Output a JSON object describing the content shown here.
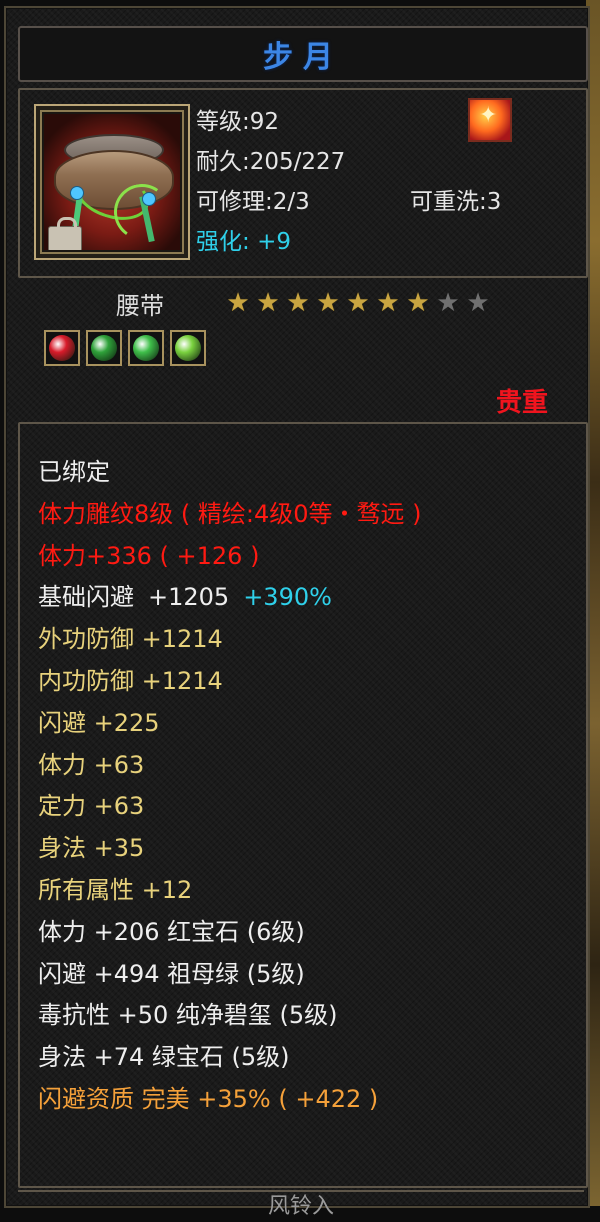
{
  "item": {
    "name": "步月",
    "level_label": "等级",
    "level_value": ":92",
    "durability_label": "耐久",
    "durability_value": ":205/227",
    "repair_label": "可修理",
    "repair_value": ":2/3",
    "rewash_label": "可重洗",
    "rewash_value": ":3",
    "enhance_label": "强化:",
    "enhance_value": "+9",
    "type": "腰带",
    "stars": {
      "filled": 7,
      "total": 9
    },
    "rarity": "贵重",
    "gems": [
      {
        "name": "ruby-gem",
        "color": "#d81b2a"
      },
      {
        "name": "emerald-gem",
        "color": "#2fa23a"
      },
      {
        "name": "jade-gem",
        "color": "#3fbf4a"
      },
      {
        "name": "green-gem",
        "color": "#7ad23f"
      }
    ],
    "icon": "belt-icon"
  },
  "attributes": [
    {
      "text": "已绑定",
      "color": "white"
    },
    {
      "text": "体力雕纹8级 ( 精绘:4级0等・骛远 )",
      "color": "red"
    },
    {
      "text": "体力+336 ( +126 )",
      "color": "red"
    },
    {
      "parts": [
        "基础闪避",
        "+1205",
        "+390%"
      ],
      "color": "white"
    },
    {
      "text": "外功防御 +1214",
      "color": "yellow"
    },
    {
      "text": "内功防御 +1214",
      "color": "yellow"
    },
    {
      "text": "闪避 +225",
      "color": "yellow"
    },
    {
      "text": "体力 +63",
      "color": "yellow"
    },
    {
      "text": "定力 +63",
      "color": "yellow"
    },
    {
      "text": "身法 +35",
      "color": "yellow"
    },
    {
      "text": "所有属性 +12",
      "color": "yellow"
    },
    {
      "text": "体力 +206 红宝石 (6级)",
      "color": "white"
    },
    {
      "text": "闪避 +494 祖母绿 (5级)",
      "color": "white"
    },
    {
      "text": "毒抗性 +50 纯净碧玺 (5级)",
      "color": "white"
    },
    {
      "text": "身法 +74 绿宝石 (5级)",
      "color": "white"
    },
    {
      "text": "闪避资质  完美 +35% ( +422 )",
      "color": "orange"
    }
  ],
  "footer": "风铃入"
}
